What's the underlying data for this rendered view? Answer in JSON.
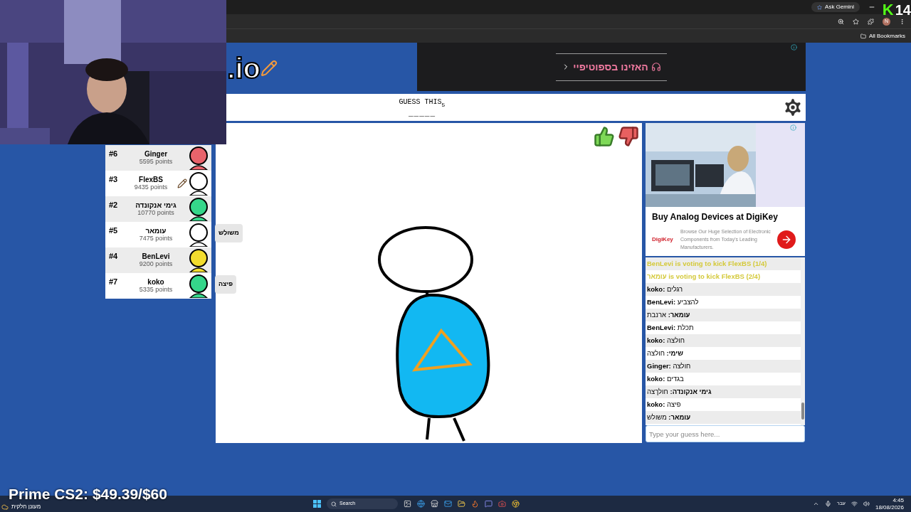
{
  "browser": {
    "gemini_button": "Ask Gemini",
    "profile_initial": "N",
    "bookmarks_label": "All Bookmarks"
  },
  "stream_overlay": {
    "viewer_logo": "K",
    "viewer_count": "14",
    "goal": "Prime CS2: $49.39/$60"
  },
  "game": {
    "logo": ".io",
    "banner_ad": {
      "text": "האזינו בספוטיפיי"
    },
    "header": {
      "label": "GUESS THIS",
      "letter_count": "5",
      "hint": "_____"
    },
    "players": [
      {
        "rank": "#6",
        "name": "Ginger",
        "points": "5595 points",
        "color": "#e8636b",
        "drawing": false
      },
      {
        "rank": "#3",
        "name": "FlexBS",
        "points": "9435 points",
        "color": "#ffffff",
        "drawing": true
      },
      {
        "rank": "#2",
        "name": "גימי אנקונדה",
        "points": "10770 points",
        "color": "#35d68a",
        "drawing": false
      },
      {
        "rank": "#5",
        "name": "עומאר",
        "points": "7475 points",
        "color": "#ffffff",
        "drawing": false,
        "bubble": "משולש"
      },
      {
        "rank": "#4",
        "name": "BenLevi",
        "points": "9200 points",
        "color": "#f2dc2e",
        "drawing": false
      },
      {
        "rank": "#7",
        "name": "koko",
        "points": "5335 points",
        "color": "#35d68a",
        "drawing": false,
        "bubble": "פיצה"
      }
    ],
    "side_ad": {
      "title": "Buy Analog Devices at DigiKey",
      "brand": "DigiKey",
      "description": "Browse Our Huge Selection of Electronic Components from Today's Leading Manufacturers."
    },
    "chat": [
      {
        "kind": "system",
        "text": "BenLevi is voting to kick FlexBS (1/4)"
      },
      {
        "kind": "system",
        "text": "עומאר is voting to kick FlexBS (2/4)"
      },
      {
        "kind": "guess",
        "name": "koko:",
        "text": "רגלים"
      },
      {
        "kind": "guess",
        "name": "BenLevi:",
        "text": "להצביע"
      },
      {
        "kind": "guess",
        "name": "עומאר:",
        "text": "ארנבת"
      },
      {
        "kind": "guess",
        "name": "BenLevi:",
        "text": "תכלת"
      },
      {
        "kind": "guess",
        "name": "koko:",
        "text": "חולצה"
      },
      {
        "kind": "guess",
        "name": "שימי:",
        "text": "חולצה"
      },
      {
        "kind": "guess",
        "name": "Ginger:",
        "text": "חולצה"
      },
      {
        "kind": "guess",
        "name": "koko:",
        "text": "בגדים"
      },
      {
        "kind": "guess",
        "name": "גימי אנקונדה:",
        "text": "חולךצה"
      },
      {
        "kind": "guess",
        "name": "koko:",
        "text": "פיצה"
      },
      {
        "kind": "guess",
        "name": "עומאר:",
        "text": "משולש"
      }
    ],
    "chat_input": {
      "placeholder": "Type your guess here..."
    }
  },
  "taskbar": {
    "weather": "מעונן חלקית",
    "search": "Search",
    "language": "עבר",
    "time": "4:45",
    "date": "18/08/2026"
  }
}
